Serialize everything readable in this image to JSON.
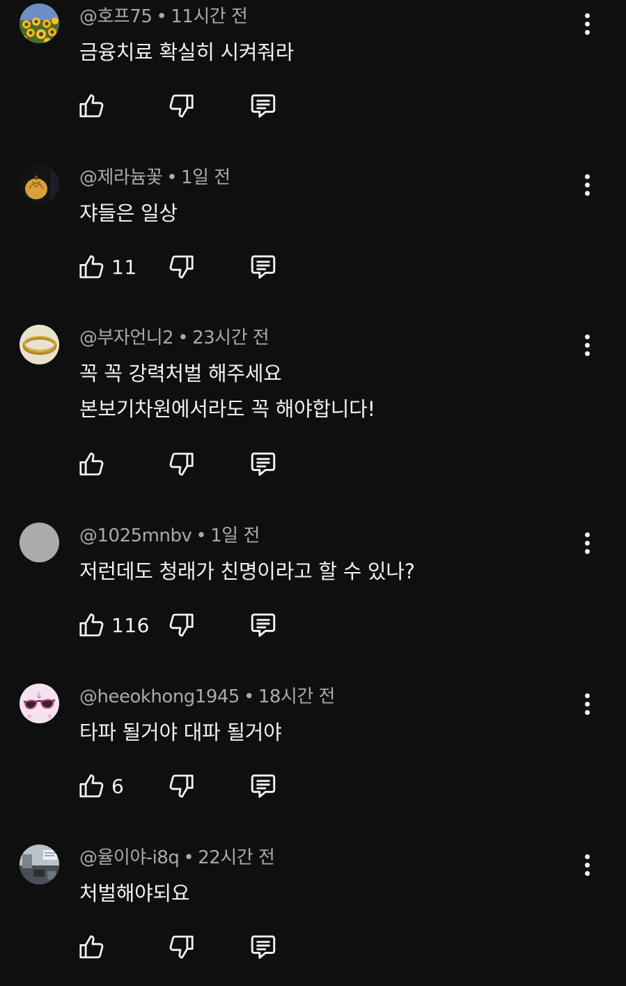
{
  "comments": [
    {
      "handle": "@호프75",
      "time": "11시간 전",
      "lines": [
        "금융치료 확실히 시켜줘라"
      ],
      "likes": "",
      "avatar": "sunflower-field-icon"
    },
    {
      "handle": "@제라늄꽃",
      "time": "1일 전",
      "lines": [
        "쟈들은 일상"
      ],
      "likes": "11",
      "avatar": "gold-pumpkin-icon"
    },
    {
      "handle": "@부자언니2",
      "time": "23시간 전",
      "lines": [
        "꼭 꼭 강력처벌 해주세요",
        "본보기차원에서라도 꼭 해야합니다!"
      ],
      "likes": "",
      "avatar": "gold-bracelet-icon"
    },
    {
      "handle": "@1025mnbv",
      "time": "1일 전",
      "lines": [
        "저런데도 청래가 친명이라고 할 수 있나?"
      ],
      "likes": "116",
      "avatar": "default-gray-avatar-icon"
    },
    {
      "handle": "@heeokhong1945",
      "time": "18시간 전",
      "lines": [
        "타파 될거야 대파 될거야"
      ],
      "likes": "6",
      "avatar": "pink-sunglasses-icon"
    },
    {
      "handle": "@율이야-i8q",
      "time": "22시간 전",
      "lines": [
        "처벌해야되요"
      ],
      "likes": "",
      "avatar": "street-scene-icon"
    }
  ],
  "separator": "•",
  "icons": {
    "like": "thumbs-up-icon",
    "dislike": "thumbs-down-icon",
    "reply": "reply-comment-icon",
    "more": "more-vertical-icon"
  },
  "colors": {
    "background": "#0f0f0f",
    "text_primary": "#f1f1f1",
    "text_secondary": "#aaaaaa"
  }
}
